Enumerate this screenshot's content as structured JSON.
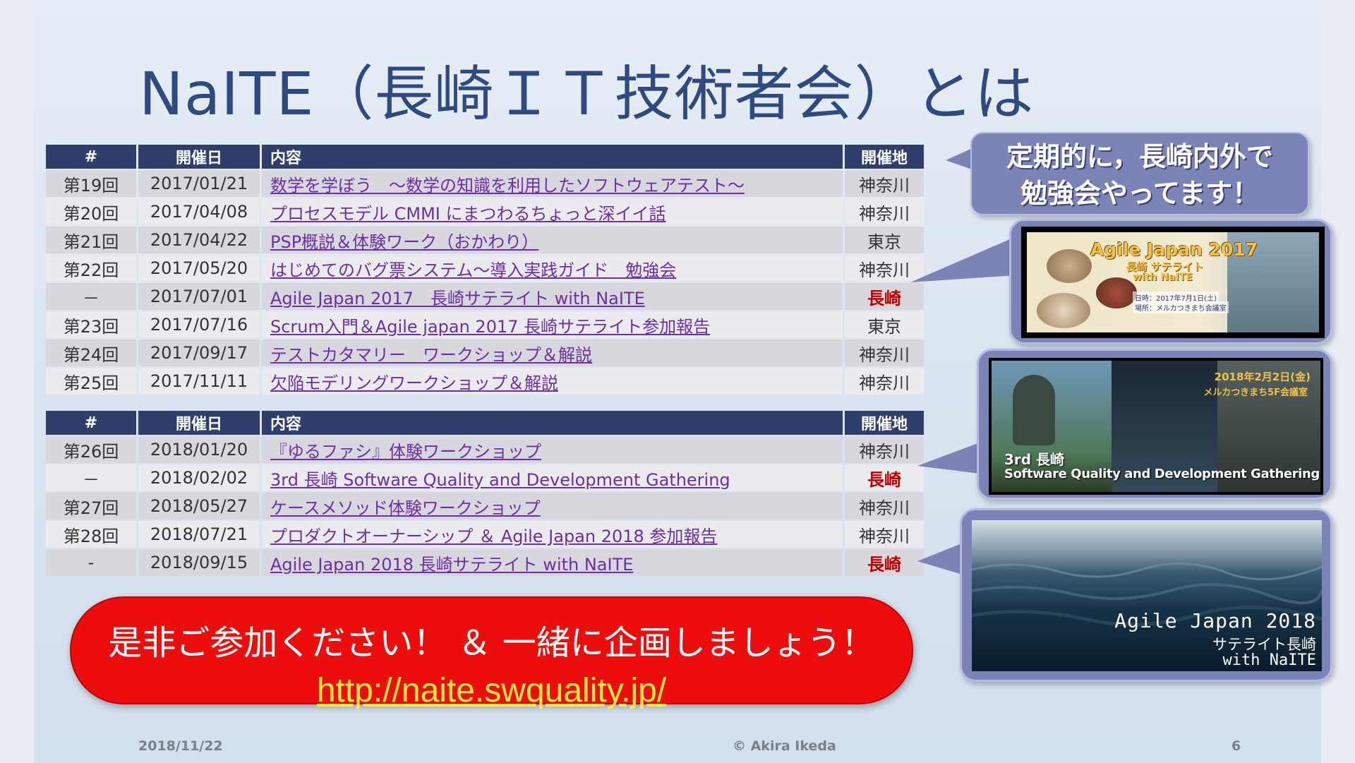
{
  "title": "NaITE（長崎ＩＴ技術者会）とは",
  "headers": {
    "num": "#",
    "date": "開催日",
    "title": "内容",
    "loc": "開催地"
  },
  "table1": [
    {
      "num": "第19回",
      "date": "2017/01/21",
      "title": "数学を学ぼう　～数学の知識を利用したソフトウェアテスト～",
      "loc": "神奈川",
      "hl": false
    },
    {
      "num": "第20回",
      "date": "2017/04/08",
      "title": "プロセスモデル CMMI にまつわるちょっと深イイ話",
      "loc": "神奈川",
      "hl": false
    },
    {
      "num": "第21回",
      "date": "2017/04/22",
      "title": "PSP概説＆体験ワーク（おかわり）",
      "loc": "東京",
      "hl": false
    },
    {
      "num": "第22回",
      "date": "2017/05/20",
      "title": "はじめてのバグ票システム～導入実践ガイド　勉強会",
      "loc": "神奈川",
      "hl": false
    },
    {
      "num": "－",
      "date": "2017/07/01",
      "title": "Agile Japan 2017　長崎サテライト with NaITE",
      "loc": "長崎",
      "hl": true
    },
    {
      "num": "第23回",
      "date": "2017/07/16",
      "title": "Scrum入門＆Agile japan 2017 長崎サテライト参加報告",
      "loc": "東京",
      "hl": false
    },
    {
      "num": "第24回",
      "date": "2017/09/17",
      "title": "テストカタマリー　ワークショップ＆解説",
      "loc": "神奈川",
      "hl": false
    },
    {
      "num": "第25回",
      "date": "2017/11/11",
      "title": "欠陥モデリングワークショップ＆解説",
      "loc": "神奈川",
      "hl": false
    }
  ],
  "table2": [
    {
      "num": "第26回",
      "date": "2018/01/20",
      "title": "『ゆるファシ』体験ワークショップ",
      "loc": "神奈川",
      "hl": false
    },
    {
      "num": "－",
      "date": "2018/02/02",
      "title": "3rd 長崎 Software Quality and Development Gathering",
      "loc": "長崎",
      "hl": true
    },
    {
      "num": "第27回",
      "date": "2018/05/27",
      "title": "ケースメソッド体験ワークショップ",
      "loc": "神奈川",
      "hl": false
    },
    {
      "num": "第28回",
      "date": "2018/07/21",
      "title": "プロダクトオーナーシップ ＆ Agile Japan 2018 参加報告",
      "loc": "神奈川",
      "hl": false
    },
    {
      "num": "-",
      "date": "2018/09/15",
      "title": "Agile Japan 2018 長崎サテライト with NaITE",
      "loc": "長崎",
      "hl": true
    }
  ],
  "callout": {
    "line1": "定期的に，長崎内外で",
    "line2": "勉強会やってます！"
  },
  "img1": {
    "title": "Agile Japan 2017",
    "sub1": "長崎 サテライト",
    "sub2": "with NaITE",
    "info1": "日時：2017年7月1日(土)",
    "info2": "場所：メルカつきまち会議室"
  },
  "img2": {
    "date": "2018年2月2日(金)",
    "place": "メルカつきまち5F会議室",
    "line1": "3rd 長崎",
    "line2": "Software Quality and Development Gathering"
  },
  "img3": {
    "line1": "Agile Japan 2018",
    "line2": "サテライト長崎",
    "line3": "with NaITE"
  },
  "promo": {
    "line1": "是非ご参加ください！ ＆ 一緒に企画しましょう！",
    "url": "http://naite.swquality.jp/"
  },
  "footer": {
    "date": "2018/11/22",
    "author": "© Akira Ikeda",
    "page": "6"
  },
  "colors": {
    "header_bg": "#2f3e6b",
    "link": "#6b2fa6",
    "highlight": "#c00000",
    "callout": "#7c83b6",
    "promo_bg": "#ee0d0d",
    "url": "#ffeb3b"
  }
}
